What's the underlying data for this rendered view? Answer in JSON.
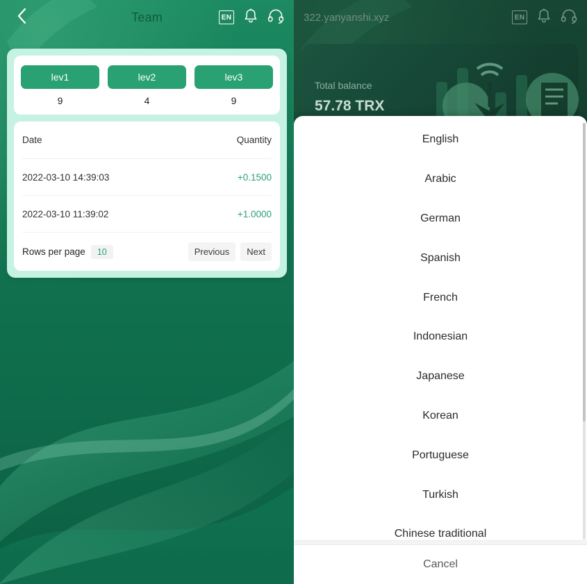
{
  "colors": {
    "brand_green": "#2aa173",
    "mint": "#c5f2e3",
    "panel_bg": "#12805a",
    "dim_overlay": "#0f3d2b",
    "positive": "#2aa173"
  },
  "left_panel": {
    "header": {
      "back_icon": "chevron-left-icon",
      "title": "Team",
      "lang_badge": "EN",
      "bell_icon": "bell-icon",
      "support_icon": "headset-icon"
    },
    "levels": [
      {
        "label": "lev1",
        "count": "9"
      },
      {
        "label": "lev2",
        "count": "4"
      },
      {
        "label": "lev3",
        "count": "9"
      }
    ],
    "table": {
      "columns": [
        "Date",
        "Quantity"
      ],
      "rows": [
        {
          "date": "2022-03-10 14:39:03",
          "quantity": "+0.1500"
        },
        {
          "date": "2022-03-10 11:39:02",
          "quantity": "+1.0000"
        }
      ]
    },
    "pagination": {
      "rows_per_page_label": "Rows per page",
      "rows_per_page_value": "10",
      "previous_label": "Previous",
      "next_label": "Next"
    }
  },
  "right_panel": {
    "header": {
      "title": "322.yanyanshi.xyz",
      "lang_badge": "EN",
      "bell_icon": "bell-icon",
      "support_icon": "headset-icon"
    },
    "balance": {
      "label": "Total balance",
      "value": "57.78 TRX"
    },
    "language_sheet": {
      "options": [
        "English",
        "Arabic",
        "German",
        "Spanish",
        "French",
        "Indonesian",
        "Japanese",
        "Korean",
        "Portuguese",
        "Turkish",
        "Chinese traditional"
      ],
      "cancel_label": "Cancel"
    }
  }
}
